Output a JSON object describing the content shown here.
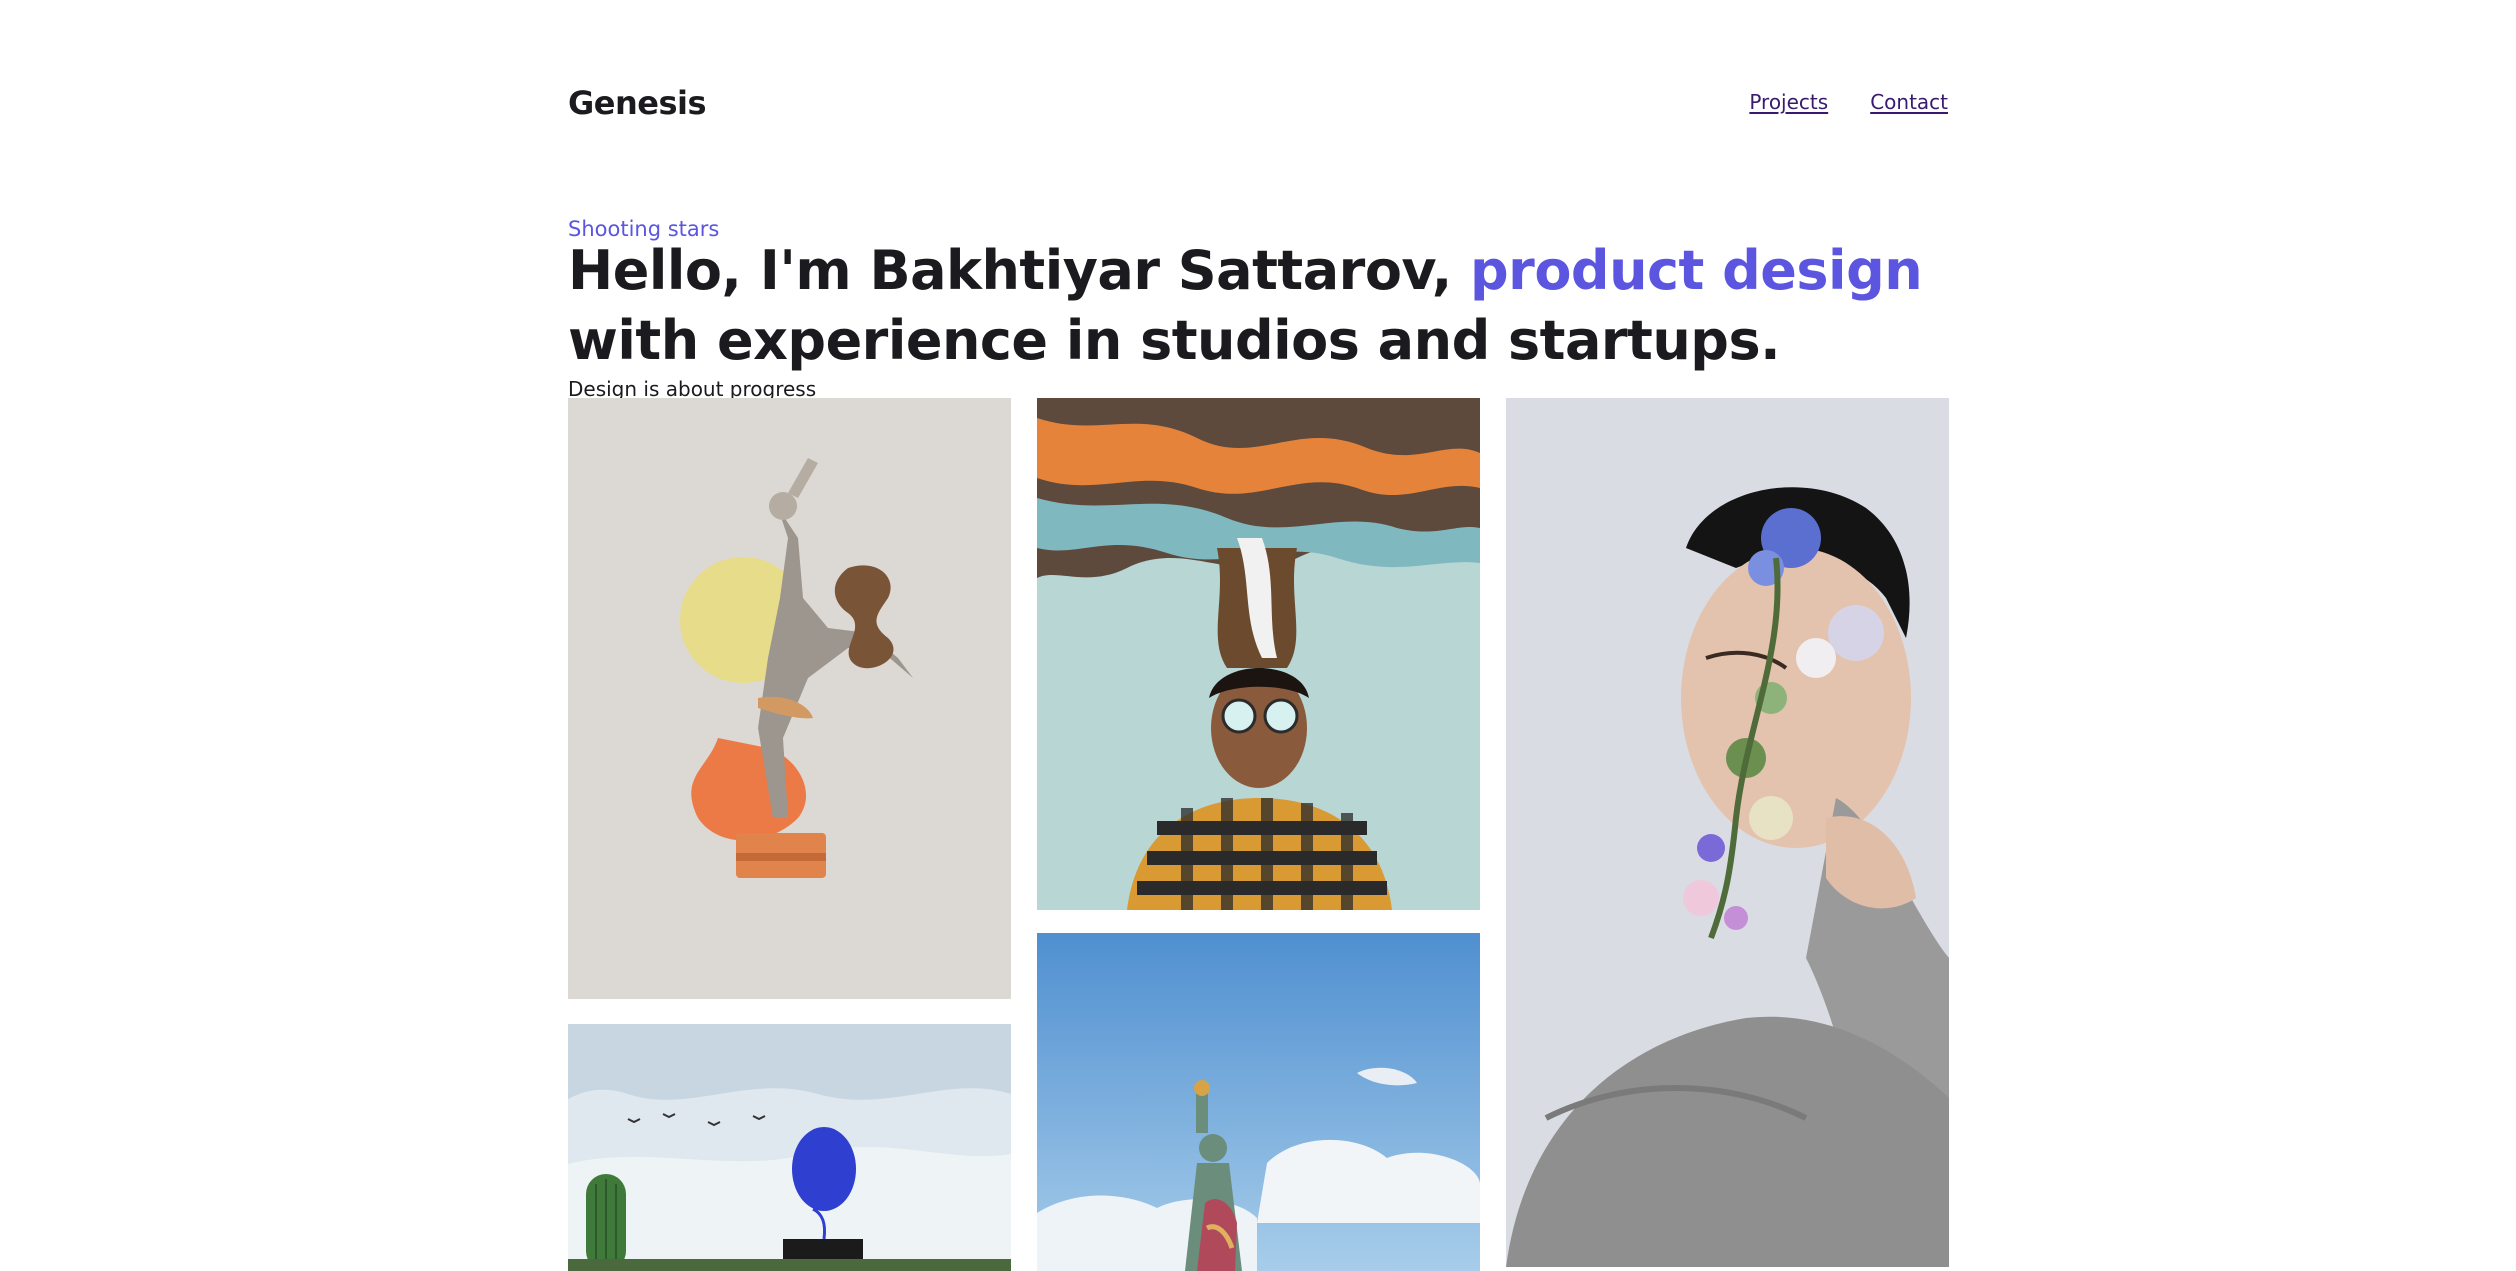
{
  "header": {
    "logo": "Genesis",
    "nav": [
      {
        "label": "Projects"
      },
      {
        "label": "Contact"
      }
    ]
  },
  "hero": {
    "eyebrow": "Shooting stars",
    "headline_part1": "Hello, I'm Bakhtiyar Sattarov, ",
    "headline_accent": "product design",
    "headline_part2": " with experience in studios and startups.",
    "subline": "Design is about progress"
  },
  "gallery": {
    "items": [
      {
        "subject": "dancer collage illustration"
      },
      {
        "subject": "man with colorful smoke illustration"
      },
      {
        "subject": "man with flowers on face"
      },
      {
        "subject": "person with blue balloon and cactus"
      },
      {
        "subject": "statue of liberty under blue sky"
      }
    ]
  },
  "colors": {
    "accent": "#5b55e0",
    "text": "#1b1b1f",
    "link": "#3a1a6e",
    "background": "#ffffff"
  }
}
